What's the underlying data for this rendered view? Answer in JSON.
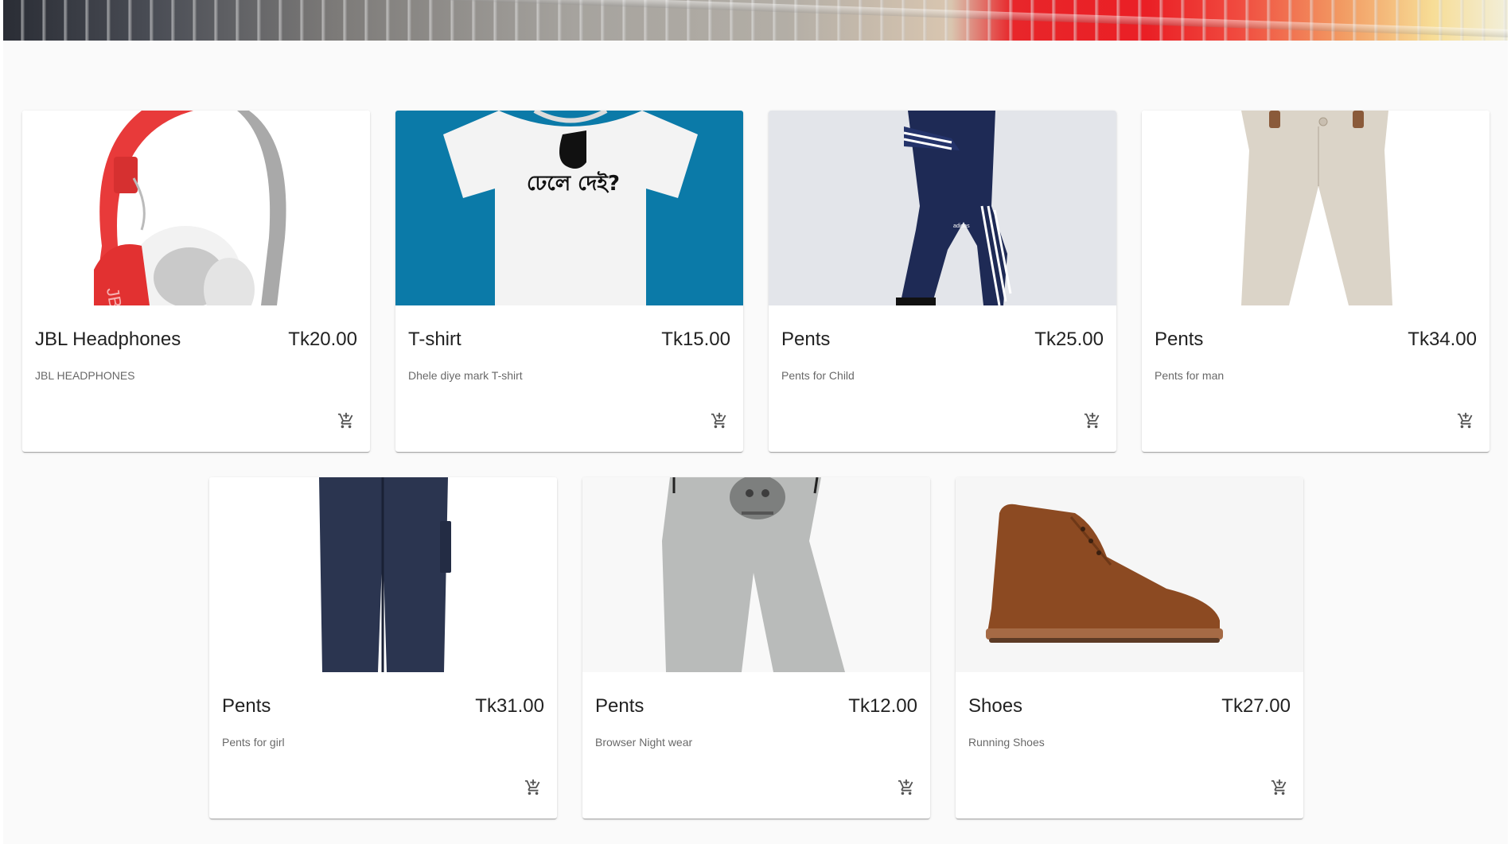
{
  "hero": {
    "icon": "shopping-cart-banner"
  },
  "products": [
    {
      "title": "JBL Headphones",
      "price": "Tk20.00",
      "description": "JBL HEADPHONES",
      "image": "headphones-image"
    },
    {
      "title": "T-shirt",
      "price": "Tk15.00",
      "description": "Dhele diye mark T-shirt",
      "image": "tshirt-image",
      "print_text": "ঢেলে দেই?"
    },
    {
      "title": "Pents",
      "price": "Tk25.00",
      "description": "Pents for Child",
      "image": "tracksuit-image",
      "brand_mark": "adidas"
    },
    {
      "title": "Pents",
      "price": "Tk34.00",
      "description": "Pents for man",
      "image": "beige-pants-image"
    },
    {
      "title": "Pents",
      "price": "Tk31.00",
      "description": "Pents for girl",
      "image": "navy-pants-image"
    },
    {
      "title": "Pents",
      "price": "Tk12.00",
      "description": "Browser Night wear",
      "image": "grey-joggers-image"
    },
    {
      "title": "Shoes",
      "price": "Tk27.00",
      "description": "Running Shoes",
      "image": "suede-boot-image"
    }
  ],
  "cart_icon": "add-shopping-cart-icon",
  "colors": {
    "accent_teal": "#0b7aa8",
    "headphone_red": "#e83a3a",
    "boot_brown": "#8c4a22",
    "navy": "#1e2a55"
  }
}
